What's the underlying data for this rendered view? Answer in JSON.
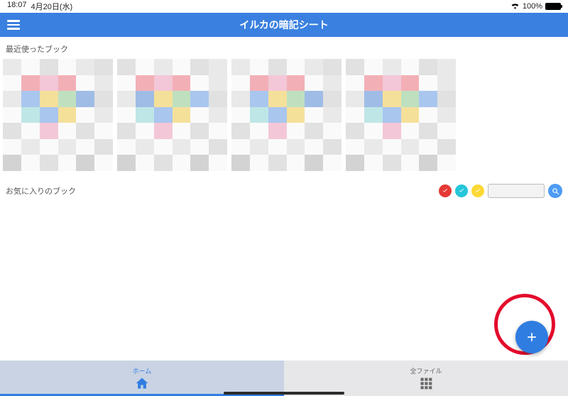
{
  "statusbar": {
    "time": "18:07",
    "date": "4月20日(水)",
    "battery": "100%"
  },
  "navbar": {
    "title": "イルカの暗記シート"
  },
  "sections": {
    "recent_label": "最近使ったブック",
    "favorites_label": "お気に入りのブック"
  },
  "recent_books": [
    {
      "id": "book1"
    },
    {
      "id": "book2"
    },
    {
      "id": "book3"
    },
    {
      "id": "book4"
    }
  ],
  "filters": {
    "red": true,
    "cyan": true,
    "yellow": true
  },
  "search": {
    "value": "",
    "placeholder": ""
  },
  "tabs": {
    "home_label": "ホーム",
    "files_label": "全ファイル"
  }
}
